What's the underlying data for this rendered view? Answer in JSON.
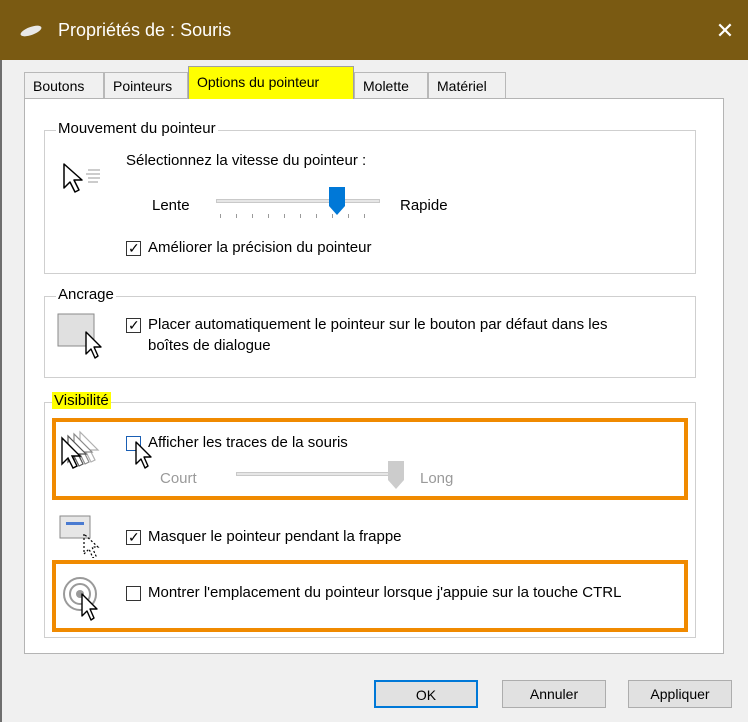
{
  "window": {
    "title": "Propriétés de : Souris",
    "close_icon": "close-icon",
    "colors": {
      "titlebar": "#7a5a12",
      "highlight_tab": "#ffff00",
      "annotation_border": "#f08a00",
      "default_button_border": "#0078d7"
    }
  },
  "tabs": [
    {
      "label": "Boutons"
    },
    {
      "label": "Pointeurs"
    },
    {
      "label": "Options du pointeur"
    },
    {
      "label": "Molette"
    },
    {
      "label": "Matériel"
    }
  ],
  "motion": {
    "legend": "Mouvement du pointeur",
    "speed_label": "Sélectionnez la vitesse du pointeur :",
    "slow_label": "Lente",
    "fast_label": "Rapide",
    "speed_value": 0.74,
    "precision_label": "Améliorer la précision du pointeur",
    "precision_checked": true
  },
  "snap": {
    "legend": "Ancrage",
    "label_line1": "Placer automatiquement le pointeur sur le bouton par défaut dans les",
    "label_line2": "boîtes de dialogue",
    "checked": true
  },
  "visibility": {
    "legend": "Visibilité",
    "trails_label": "Afficher les traces de la souris",
    "trails_checked": false,
    "short_label": "Court",
    "long_label": "Long",
    "trail_length_value": 1.0,
    "hide_label": "Masquer le pointeur pendant la frappe",
    "hide_checked": true,
    "ctrl_label": "Montrer l'emplacement du pointeur lorsque j'appuie sur la touche CTRL",
    "ctrl_checked": false
  },
  "buttons": {
    "ok": "OK",
    "cancel": "Annuler",
    "apply": "Appliquer"
  }
}
